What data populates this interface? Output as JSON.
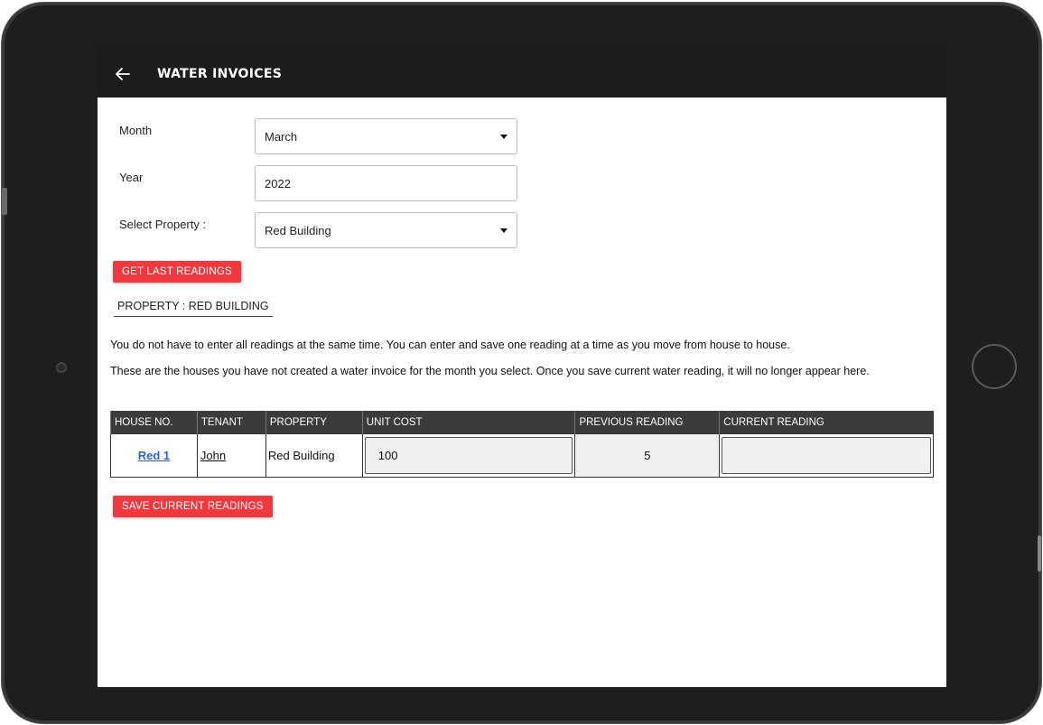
{
  "header": {
    "title": "WATER INVOICES"
  },
  "form": {
    "month": {
      "label": "Month",
      "value": "March"
    },
    "year": {
      "label": "Year",
      "value": "2022"
    },
    "property": {
      "label": "Select Property :",
      "value": "Red Building"
    }
  },
  "buttons": {
    "get_last_readings": "GET LAST READINGS",
    "save_current_readings": "SAVE CURRENT READINGS"
  },
  "property_heading": "PROPERTY : RED BUILDING",
  "info": {
    "line1": "You do not have to enter all readings at the same time. You can enter and save one reading at a time as you move from house to house.",
    "line2": "These are the houses you have not created a water invoice for the month you select. Once you save current water reading, it will no longer appear here."
  },
  "table": {
    "headers": [
      "HOUSE NO.",
      "TENANT",
      "PROPERTY",
      "UNIT COST",
      "PREVIOUS READING",
      "CURRENT READING"
    ],
    "rows": [
      {
        "house_no": "Red 1",
        "tenant": "John",
        "property": "Red Building",
        "unit_cost": "100",
        "previous_reading": "5",
        "current_reading": ""
      }
    ]
  },
  "colors": {
    "topbar": "#1c1c1c",
    "accent_button": "#f0383f",
    "link": "#2667c9"
  }
}
